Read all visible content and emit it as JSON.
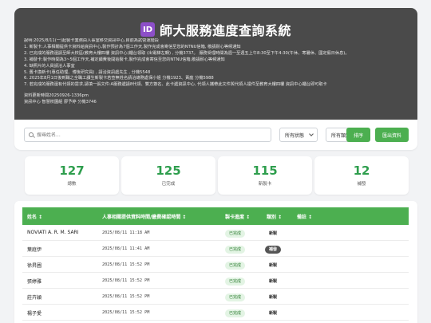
{
  "header": {
    "badge": "ID",
    "title": "師大服務進度查詢系統",
    "notes": [
      "說明:2025/8/11(一)起製卡業務由人事室移交資訊中心,目前為試營運階段",
      "1. 新製卡:人事相關提供卡資料給資訊中心,製作預計為7個工作天,製作完成會寄信至您的NTNU信箱, 敬請耐心等候通知",
      "2. 已完成的服務還請至師大校區(教育大樓四樓 資訊中心)櫃台領取  (出電梯左轉) , 分機3737。 服務受理時間為週一至週五上午8:30至下午4:30(午休、寒暑休、國定假日休息)。",
      "3. 補發卡:製作時間為3~5個工作天,補定續費後開始製卡,製作完成會寄信至您的NTNU信箱,敬請耐心等候通知",
      "4. 缺照片的人員請洽人事室",
      "5. 舊卡換新卡(專任助理、博後研究員) , 請洽資訊處先生 , 分機5548",
      "6. 2025年8月1日後到職之全職工讀生新製卡若查無姓名請洽總務處保小姐 分機1923、黃庭 分機5988",
      "7. 若完成的服務還有代領的需求,請填一張文件:A服務遞請8代領、雙方簽名、此卡遞資訊中心, 代領人攜帶此文件與代領人證件至教育大樓四樓 資訊中心櫃台即可取卡"
    ],
    "update_line": "資料更新時間20250926-1336pm",
    "contact_line": "資訊中心 智慧校園組 廖予婷 分機3746"
  },
  "filters": {
    "search_placeholder": "搜尋姓名...",
    "status_select": "所有狀態",
    "category_select": "所有類別",
    "sort_button": "排序",
    "export_button": "匯出資料"
  },
  "stats": [
    {
      "value": "127",
      "label": "總數"
    },
    {
      "value": "125",
      "label": "已完成"
    },
    {
      "value": "115",
      "label": "新製卡"
    },
    {
      "value": "12",
      "label": "補發"
    }
  ],
  "table": {
    "headers": {
      "name": "姓名 ↕",
      "time": "人事相關提供資料時間/繳費確認時間 ↕",
      "progress": "製卡進度 ↕",
      "category": "類別 ↕",
      "remarks": "備註 ↕"
    },
    "rows": [
      {
        "name": "NOVIATI A. R. M. SARI",
        "time": "2025/08/11 11:18 AM",
        "progress": "已完成",
        "category": "新製"
      },
      {
        "name": "葉庭伊",
        "time": "2025/08/11 11:41 AM",
        "progress": "已完成",
        "category": "補發"
      },
      {
        "name": "徐昇圃",
        "time": "2025/08/11 15:52 PM",
        "progress": "已完成",
        "category": "新製"
      },
      {
        "name": "張婷雅",
        "time": "2025/08/11 15:52 PM",
        "progress": "已完成",
        "category": "新製"
      },
      {
        "name": "莊卉穎",
        "time": "2025/08/11 15:52 PM",
        "progress": "已完成",
        "category": "新製"
      },
      {
        "name": "楊子愛",
        "time": "2025/08/11 15:52 PM",
        "progress": "已完成",
        "category": "新製"
      }
    ]
  }
}
